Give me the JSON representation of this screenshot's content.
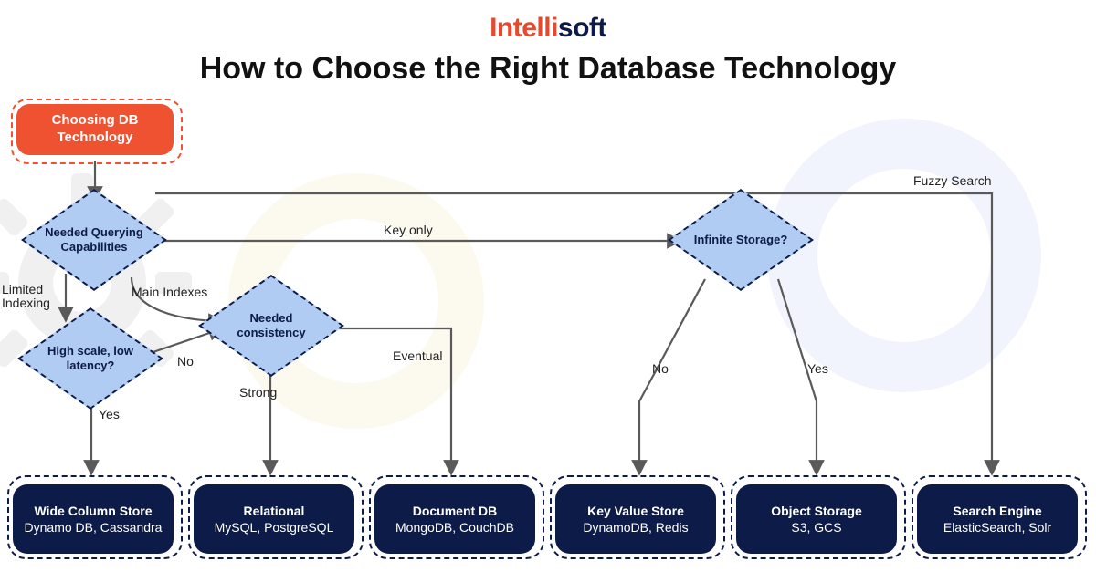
{
  "logo": {
    "part1": "Intelli",
    "part2": "soft"
  },
  "title": "How to Choose the Right Database Technology",
  "start": "Choosing DB Technology",
  "decisions": {
    "d1": "Needed Querying Capabilities",
    "d2": "High scale, low latency?",
    "d3": "Needed consistency",
    "d4": "Infinite Storage?"
  },
  "edgeLabels": {
    "fuzzy": "Fuzzy Search",
    "keyonly": "Key only",
    "mainidx": "Main Indexes",
    "limidx": "Limited Indexing",
    "no1": "No",
    "yes1": "Yes",
    "strong": "Strong",
    "eventual": "Eventual",
    "no2": "No",
    "yes2": "Yes"
  },
  "results": [
    {
      "title": "Wide Column Store",
      "sub": "Dynamo DB, Cassandra"
    },
    {
      "title": "Relational",
      "sub": "MySQL, PostgreSQL"
    },
    {
      "title": "Document DB",
      "sub": "MongoDB, CouchDB"
    },
    {
      "title": "Key Value Store",
      "sub": "DynamoDB, Redis"
    },
    {
      "title": "Object Storage",
      "sub": "S3, GCS"
    },
    {
      "title": "Search Engine",
      "sub": "ElasticSearch, Solr"
    }
  ]
}
